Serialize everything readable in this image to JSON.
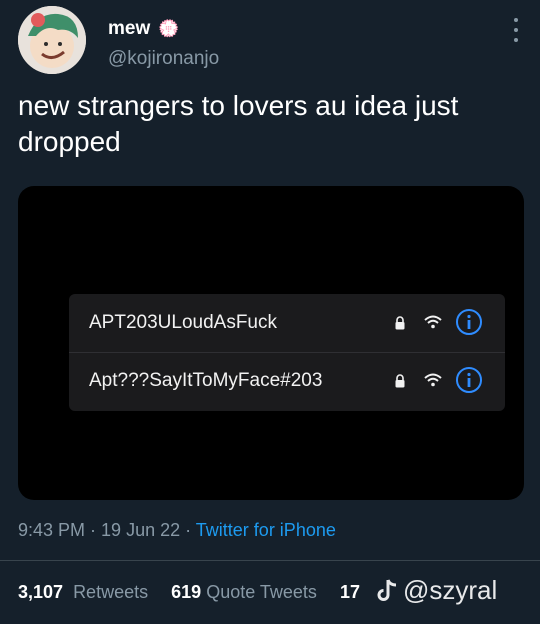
{
  "tweet": {
    "author": {
      "display_name": "mew",
      "emoji": "💮",
      "handle": "@kojironanjo"
    },
    "text": "new strangers to lovers au idea just dropped",
    "media": {
      "networks": [
        {
          "name": "APT203ULoudAsFuck",
          "secured": true
        },
        {
          "name": "Apt???SayItToMyFace#203",
          "secured": true
        }
      ]
    },
    "meta": {
      "time": "9:43 PM",
      "separator": " · ",
      "date": "19 Jun 22",
      "source": "Twitter for iPhone"
    },
    "stats": {
      "retweets": {
        "count": "3,107",
        "label": "Retweets"
      },
      "quote_tweets": {
        "count": "619",
        "label": "Quote Tweets"
      },
      "likes_partial": "17"
    },
    "watermark": "@szyral"
  },
  "colors": {
    "background": "#15202b",
    "accent": "#1d9bf0",
    "muted": "#8899a6"
  }
}
